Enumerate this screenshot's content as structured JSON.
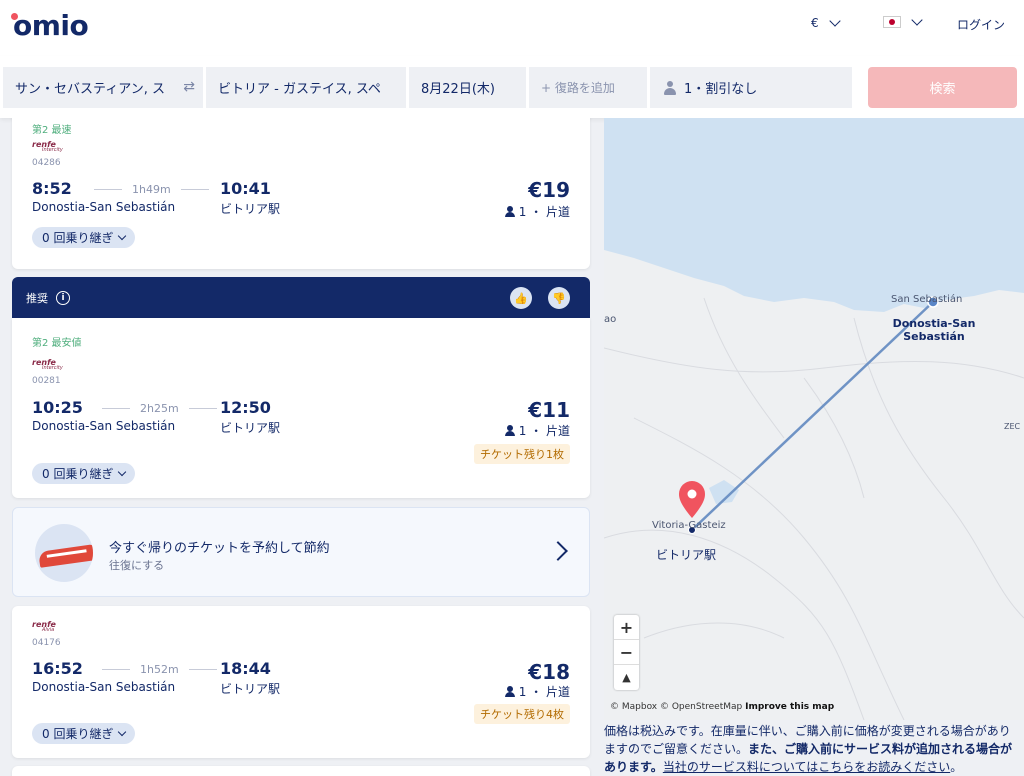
{
  "header": {
    "logo": "omio",
    "currency": "€",
    "login": "ログイン"
  },
  "search": {
    "origin": "サン・セバスティアン, ス",
    "destination": "ビトリア - ガステイス, スペ",
    "date": "8月22日(木)",
    "return_placeholder": "+ 復路を追加",
    "passengers": "1・割引なし",
    "search_button": "検索"
  },
  "results": [
    {
      "tag": "第2 最速",
      "operator": "renfe",
      "operator_sub": "Intercity",
      "train_no": "04286",
      "depart": "8:52",
      "duration": "1h49m",
      "arrive": "10:41",
      "from": "Donostia-San Sebastián",
      "to": "ビトリア駅",
      "price": "€19",
      "pax": "1 ・ 片道",
      "transfers": "0 回乗り継ぎ",
      "seats_left": ""
    },
    {
      "tag": "第2 最安値",
      "operator": "renfe",
      "operator_sub": "Intercity",
      "train_no": "00281",
      "depart": "10:25",
      "duration": "2h25m",
      "arrive": "12:50",
      "from": "Donostia-San Sebastián",
      "to": "ビトリア駅",
      "price": "€11",
      "pax": "1 ・ 片道",
      "transfers": "0 回乗り継ぎ",
      "seats_left": "チケット残り1枚"
    },
    {
      "tag": "",
      "operator": "renfe",
      "operator_sub": "Alvia",
      "train_no": "04176",
      "depart": "16:52",
      "duration": "1h52m",
      "arrive": "18:44",
      "from": "Donostia-San Sebastián",
      "to": "ビトリア駅",
      "price": "€18",
      "pax": "1 ・ 片道",
      "transfers": "0 回乗り継ぎ",
      "seats_left": "チケット残り4枚"
    }
  ],
  "recommended": {
    "label": "推奨",
    "info": "i"
  },
  "promo": {
    "title": "今すぐ帰りのチケットを予約して節約",
    "subtitle": "往復にする"
  },
  "map": {
    "label_ao": "ao",
    "label_zec": "ZEC",
    "origin_small": "San Sebastián",
    "origin_name": "Donostia-San Sebastián",
    "dest_small": "Vitoria-Gasteiz",
    "dest_name": "ビトリア駅",
    "zoom_in": "+",
    "zoom_out": "−",
    "compass": "▲",
    "attribution_a": "© Mapbox © OpenStreetMap ",
    "attribution_b": "Improve this map"
  },
  "disclaimer": {
    "text1": "価格は税込みです。在庫量に伴い、ご購入前に価格が変更される場合がありますのでご留意ください。",
    "text2": "また、ご購入前にサービス料が追加される場合があります。",
    "link": "当社のサービス料についてはこちらをお読みください",
    "end": "。"
  },
  "colors": {
    "brand": "#132968",
    "accent": "#f0545f",
    "search_button": "#f5b8ba",
    "tag_green": "#4fae7d"
  }
}
